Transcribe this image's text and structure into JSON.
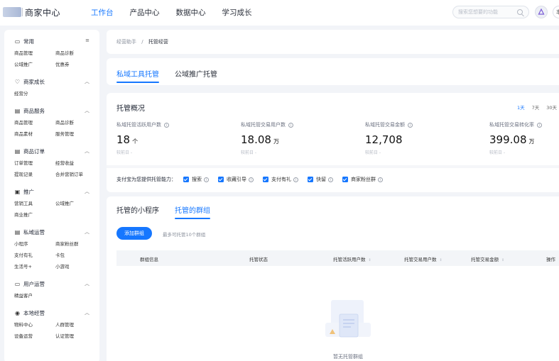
{
  "header": {
    "app_title": "商家中心",
    "nav": [
      "工作台",
      "产品中心",
      "数据中心",
      "学习成长"
    ],
    "nav_active": 0,
    "search_placeholder": "搜索您想要的功能",
    "user_badge": "丰"
  },
  "sidebar": {
    "groups": [
      {
        "title": "常用",
        "icon": "folder-icon",
        "toggle": "menu-icon",
        "items": [
          "商品管理",
          "商品诊断",
          "公域推广",
          "优惠券"
        ]
      },
      {
        "title": "商家成长",
        "icon": "heart-icon",
        "toggle": "chevron-up-icon",
        "items": [
          "经营分"
        ]
      },
      {
        "title": "商品服务",
        "icon": "document-icon",
        "toggle": "chevron-up-icon",
        "items": [
          "商品管理",
          "商品诊断",
          "商品素材",
          "服务管理"
        ]
      },
      {
        "title": "商品订单",
        "icon": "order-icon",
        "toggle": "chevron-up-icon",
        "items": [
          "订单管理",
          "经营收益",
          "提现记录",
          "合并营销订单"
        ]
      },
      {
        "title": "推广",
        "icon": "promotion-icon",
        "toggle": "chevron-up-icon",
        "items": [
          "营销工具",
          "公域推广",
          "商业推广"
        ]
      },
      {
        "title": "私域运营",
        "icon": "private-domain-icon",
        "toggle": "chevron-up-icon",
        "items": [
          "小程序",
          "商家粉丝群",
          "支付有礼",
          "卡包",
          "生活号+",
          "小游戏"
        ]
      },
      {
        "title": "用户运营",
        "icon": "user-ops-icon",
        "toggle": "chevron-up-icon",
        "items": [
          "精益客户"
        ]
      },
      {
        "title": "本地经营",
        "icon": "local-icon",
        "toggle": "chevron-up-icon",
        "items": [
          "物料中心",
          "人群管理",
          "设备运营",
          "认证管理"
        ]
      }
    ]
  },
  "breadcrumb": {
    "parent": "经营助手",
    "separator": "/",
    "current": "托管经营"
  },
  "main_tabs": {
    "items": [
      "私域工具托管",
      "公域推广托管"
    ],
    "active": 0
  },
  "overview": {
    "title": "托管概况",
    "ranges": [
      "1天",
      "7天",
      "30天"
    ],
    "range_active": 0,
    "metrics": [
      {
        "label": "私域托管活跃用户数",
        "value": "18",
        "unit": "个",
        "compare": "较前日  -"
      },
      {
        "label": "私域托管交易用户数",
        "value": "18.08",
        "unit": "万",
        "compare": "较前日  -"
      },
      {
        "label": "私域托管交易金额",
        "value": "12,708",
        "unit": "",
        "compare": "较前日  -"
      },
      {
        "label": "私域托管交易转化率",
        "value": "399.08",
        "unit": "万",
        "compare": "较前日  -"
      }
    ],
    "abilities_label": "支付宝为您提供托管能力：",
    "abilities": [
      "搜索",
      "收藏引导",
      "支付有礼",
      "快留",
      "商家粉丝群"
    ]
  },
  "groups_section": {
    "tabs": [
      "托管的小程序",
      "托管的群组"
    ],
    "active": 1,
    "add_button": "添加群组",
    "hint": "最多可托管10个群组",
    "columns": [
      "群组信息",
      "托管状态",
      "托管活跃用户数",
      "托管交易用户数",
      "托管交易金额",
      "操作"
    ],
    "empty_text": "暂无托管群组"
  },
  "colors": {
    "accent": "#1677ff",
    "background": "#f2f4f8"
  }
}
